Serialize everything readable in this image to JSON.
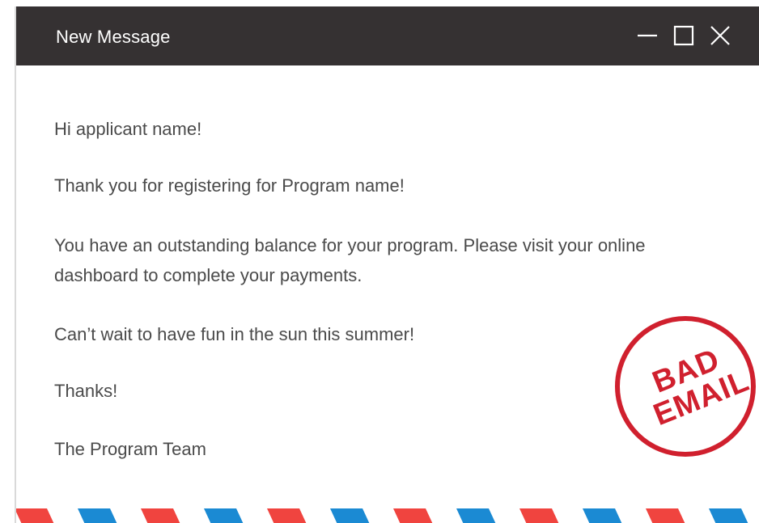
{
  "window": {
    "title": "New Message",
    "controls": [
      "minimize-icon",
      "maximize-icon",
      "close-icon"
    ]
  },
  "message": {
    "greeting": "Hi applicant name!",
    "thanks_line": "Thank you for registering for Program name!",
    "balance_line": "You have an outstanding balance for your program. Please visit your online dashboard to complete your payments.",
    "closing_line": "Can’t wait to have fun in the sun this summer!",
    "signoff": "Thanks!",
    "signature": "The Program Team"
  },
  "stamp": {
    "line1": "BAD",
    "line2": "EMAIL",
    "color": "#d0202e"
  },
  "colors": {
    "titlebar": "#353132",
    "text": "#4a4a4a",
    "airmail_red": "#f0443f",
    "airmail_blue": "#1b8ad3"
  }
}
